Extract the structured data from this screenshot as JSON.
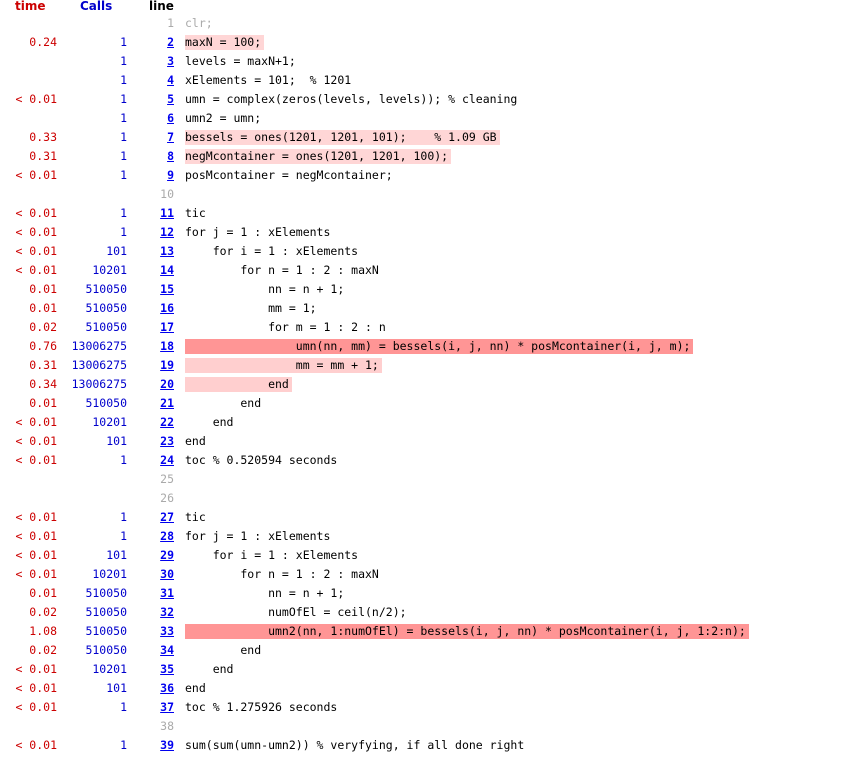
{
  "header": {
    "time": "time",
    "calls": "Calls",
    "line": "line"
  },
  "colors": {
    "time": "#cc0000",
    "calls": "#0000cc",
    "line_link": "#0000ee",
    "uncalled": "#aaaaaa",
    "highlight_light": "#ffd6d6",
    "highlight_medium": "#ffcfcf",
    "highlight_strong": "#ff9595"
  },
  "rows": [
    {
      "time": "",
      "calls": "",
      "line": "1",
      "code": "clr;",
      "linked": false,
      "hl": ""
    },
    {
      "time": "0.24",
      "calls": "1",
      "line": "2",
      "code": "maxN = 100;",
      "linked": true,
      "hl": "h1"
    },
    {
      "time": "",
      "calls": "1",
      "line": "3",
      "code": "levels = maxN+1;",
      "linked": true,
      "hl": ""
    },
    {
      "time": "",
      "calls": "1",
      "line": "4",
      "code": "xElements = 101;  % 1201",
      "linked": true,
      "hl": ""
    },
    {
      "time": "< 0.01",
      "calls": "1",
      "line": "5",
      "code": "umn = complex(zeros(levels, levels)); % cleaning",
      "linked": true,
      "hl": ""
    },
    {
      "time": "",
      "calls": "1",
      "line": "6",
      "code": "umn2 = umn;",
      "linked": true,
      "hl": ""
    },
    {
      "time": "0.33",
      "calls": "1",
      "line": "7",
      "code": "bessels = ones(1201, 1201, 101);    % 1.09 GB",
      "linked": true,
      "hl": "h1"
    },
    {
      "time": "0.31",
      "calls": "1",
      "line": "8",
      "code": "negMcontainer = ones(1201, 1201, 100);",
      "linked": true,
      "hl": "h1"
    },
    {
      "time": "< 0.01",
      "calls": "1",
      "line": "9",
      "code": "posMcontainer = negMcontainer;",
      "linked": true,
      "hl": ""
    },
    {
      "time": "",
      "calls": "",
      "line": "10",
      "code": "",
      "linked": false,
      "hl": ""
    },
    {
      "time": "< 0.01",
      "calls": "1",
      "line": "11",
      "code": "tic",
      "linked": true,
      "hl": ""
    },
    {
      "time": "< 0.01",
      "calls": "1",
      "line": "12",
      "code": "for j = 1 : xElements",
      "linked": true,
      "hl": ""
    },
    {
      "time": "< 0.01",
      "calls": "101",
      "line": "13",
      "code": "    for i = 1 : xElements",
      "linked": true,
      "hl": ""
    },
    {
      "time": "< 0.01",
      "calls": "10201",
      "line": "14",
      "code": "        for n = 1 : 2 : maxN",
      "linked": true,
      "hl": ""
    },
    {
      "time": "0.01",
      "calls": "510050",
      "line": "15",
      "code": "            nn = n + 1;",
      "linked": true,
      "hl": ""
    },
    {
      "time": "0.01",
      "calls": "510050",
      "line": "16",
      "code": "            mm = 1;",
      "linked": true,
      "hl": ""
    },
    {
      "time": "0.02",
      "calls": "510050",
      "line": "17",
      "code": "            for m = 1 : 2 : n",
      "linked": true,
      "hl": ""
    },
    {
      "time": "0.76",
      "calls": "13006275",
      "line": "18",
      "code": "                umn(nn, mm) = bessels(i, j, nn) * posMcontainer(i, j, m);",
      "linked": true,
      "hl": "h3"
    },
    {
      "time": "0.31",
      "calls": "13006275",
      "line": "19",
      "code": "                mm = mm + 1;",
      "linked": true,
      "hl": "h2"
    },
    {
      "time": "0.34",
      "calls": "13006275",
      "line": "20",
      "code": "            end",
      "linked": true,
      "hl": "h2"
    },
    {
      "time": "0.01",
      "calls": "510050",
      "line": "21",
      "code": "        end",
      "linked": true,
      "hl": ""
    },
    {
      "time": "< 0.01",
      "calls": "10201",
      "line": "22",
      "code": "    end",
      "linked": true,
      "hl": ""
    },
    {
      "time": "< 0.01",
      "calls": "101",
      "line": "23",
      "code": "end",
      "linked": true,
      "hl": ""
    },
    {
      "time": "< 0.01",
      "calls": "1",
      "line": "24",
      "code": "toc % 0.520594 seconds",
      "linked": true,
      "hl": ""
    },
    {
      "time": "",
      "calls": "",
      "line": "25",
      "code": "",
      "linked": false,
      "hl": ""
    },
    {
      "time": "",
      "calls": "",
      "line": "26",
      "code": "",
      "linked": false,
      "hl": ""
    },
    {
      "time": "< 0.01",
      "calls": "1",
      "line": "27",
      "code": "tic",
      "linked": true,
      "hl": ""
    },
    {
      "time": "< 0.01",
      "calls": "1",
      "line": "28",
      "code": "for j = 1 : xElements",
      "linked": true,
      "hl": ""
    },
    {
      "time": "< 0.01",
      "calls": "101",
      "line": "29",
      "code": "    for i = 1 : xElements",
      "linked": true,
      "hl": ""
    },
    {
      "time": "< 0.01",
      "calls": "10201",
      "line": "30",
      "code": "        for n = 1 : 2 : maxN",
      "linked": true,
      "hl": ""
    },
    {
      "time": "0.01",
      "calls": "510050",
      "line": "31",
      "code": "            nn = n + 1;",
      "linked": true,
      "hl": ""
    },
    {
      "time": "0.02",
      "calls": "510050",
      "line": "32",
      "code": "            numOfEl = ceil(n/2);",
      "linked": true,
      "hl": ""
    },
    {
      "time": "1.08",
      "calls": "510050",
      "line": "33",
      "code": "            umn2(nn, 1:numOfEl) = bessels(i, j, nn) * posMcontainer(i, j, 1:2:n);",
      "linked": true,
      "hl": "h3"
    },
    {
      "time": "0.02",
      "calls": "510050",
      "line": "34",
      "code": "        end",
      "linked": true,
      "hl": ""
    },
    {
      "time": "< 0.01",
      "calls": "10201",
      "line": "35",
      "code": "    end",
      "linked": true,
      "hl": ""
    },
    {
      "time": "< 0.01",
      "calls": "101",
      "line": "36",
      "code": "end",
      "linked": true,
      "hl": ""
    },
    {
      "time": "< 0.01",
      "calls": "1",
      "line": "37",
      "code": "toc % 1.275926 seconds",
      "linked": true,
      "hl": ""
    },
    {
      "time": "",
      "calls": "",
      "line": "38",
      "code": "",
      "linked": false,
      "hl": ""
    },
    {
      "time": "< 0.01",
      "calls": "1",
      "line": "39",
      "code": "sum(sum(umn-umn2)) % veryfying, if all done right",
      "linked": true,
      "hl": ""
    }
  ]
}
